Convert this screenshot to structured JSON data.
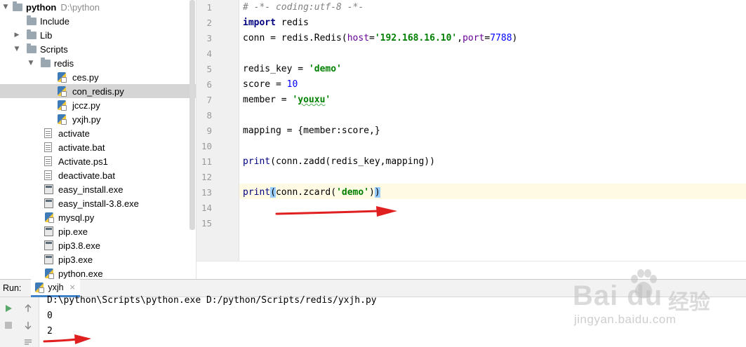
{
  "project_tree": {
    "root": {
      "name": "python",
      "path": "D:\\python"
    },
    "items": [
      {
        "label": "Include",
        "type": "folder",
        "arrow": ""
      },
      {
        "label": "Lib",
        "type": "folder",
        "arrow": "collapsed"
      },
      {
        "label": "Scripts",
        "type": "folder",
        "arrow": "expanded"
      },
      {
        "label": "redis",
        "type": "folder",
        "arrow": "expanded"
      },
      {
        "label": "ces.py",
        "type": "py"
      },
      {
        "label": "con_redis.py",
        "type": "py",
        "selected": true
      },
      {
        "label": "jccz.py",
        "type": "py"
      },
      {
        "label": "yxjh.py",
        "type": "py"
      },
      {
        "label": "activate",
        "type": "file"
      },
      {
        "label": "activate.bat",
        "type": "file"
      },
      {
        "label": "Activate.ps1",
        "type": "file"
      },
      {
        "label": "deactivate.bat",
        "type": "file"
      },
      {
        "label": "easy_install.exe",
        "type": "exe"
      },
      {
        "label": "easy_install-3.8.exe",
        "type": "exe"
      },
      {
        "label": "mysql.py",
        "type": "py"
      },
      {
        "label": "pip.exe",
        "type": "exe"
      },
      {
        "label": "pip3.8.exe",
        "type": "exe"
      },
      {
        "label": "pip3.exe",
        "type": "exe"
      },
      {
        "label": "python.exe",
        "type": "exe"
      }
    ]
  },
  "editor": {
    "line_numbers": [
      "1",
      "2",
      "3",
      "4",
      "5",
      "6",
      "7",
      "8",
      "9",
      "10",
      "11",
      "12",
      "13",
      "14",
      "15"
    ],
    "current_line": 13,
    "code": {
      "l1": "# -*- coding:utf-8 -*-",
      "l2_kw": "import",
      "l2_rest": " redis",
      "l3_a": "conn = redis.Redis(",
      "l3_param1": "host",
      "l3_eq1": "=",
      "l3_str": "'192.168.16.10'",
      "l3_comma": ",",
      "l3_param2": "port",
      "l3_eq2": "=",
      "l3_num": "7788",
      "l3_close": ")",
      "l5_a": "redis_key = ",
      "l5_str": "'demo'",
      "l6_a": "score = ",
      "l6_num": "10",
      "l7_a": "member = ",
      "l7_str_q1": "'",
      "l7_str_word": "youxu",
      "l7_str_q2": "'",
      "l9": "mapping = {member:score,}",
      "l11_fn": "print",
      "l11_rest": "(conn.zadd(redis_key,mapping))",
      "l13_fn": "print",
      "l13_open": "(",
      "l13_a": "conn.zcard(",
      "l13_str": "'demo'",
      "l13_b": ")",
      "l13_close": ")"
    }
  },
  "run_panel": {
    "title": "Run:",
    "tab_label": "yxjh",
    "tab_close": "×",
    "output": [
      "D:\\python\\Scripts\\python.exe D:/python/Scripts/redis/yxjh.py",
      "0",
      "2"
    ]
  },
  "watermark": {
    "brand": "Bai  du",
    "cn": "经验",
    "url": "jingyan.baidu.com"
  },
  "colors": {
    "annotation_arrow": "#e02020",
    "keyword": "#000080",
    "string": "#008000",
    "number": "#0000ff",
    "param": "#660099",
    "current_line": "#fffae3",
    "selection": "#d5d5d5"
  }
}
